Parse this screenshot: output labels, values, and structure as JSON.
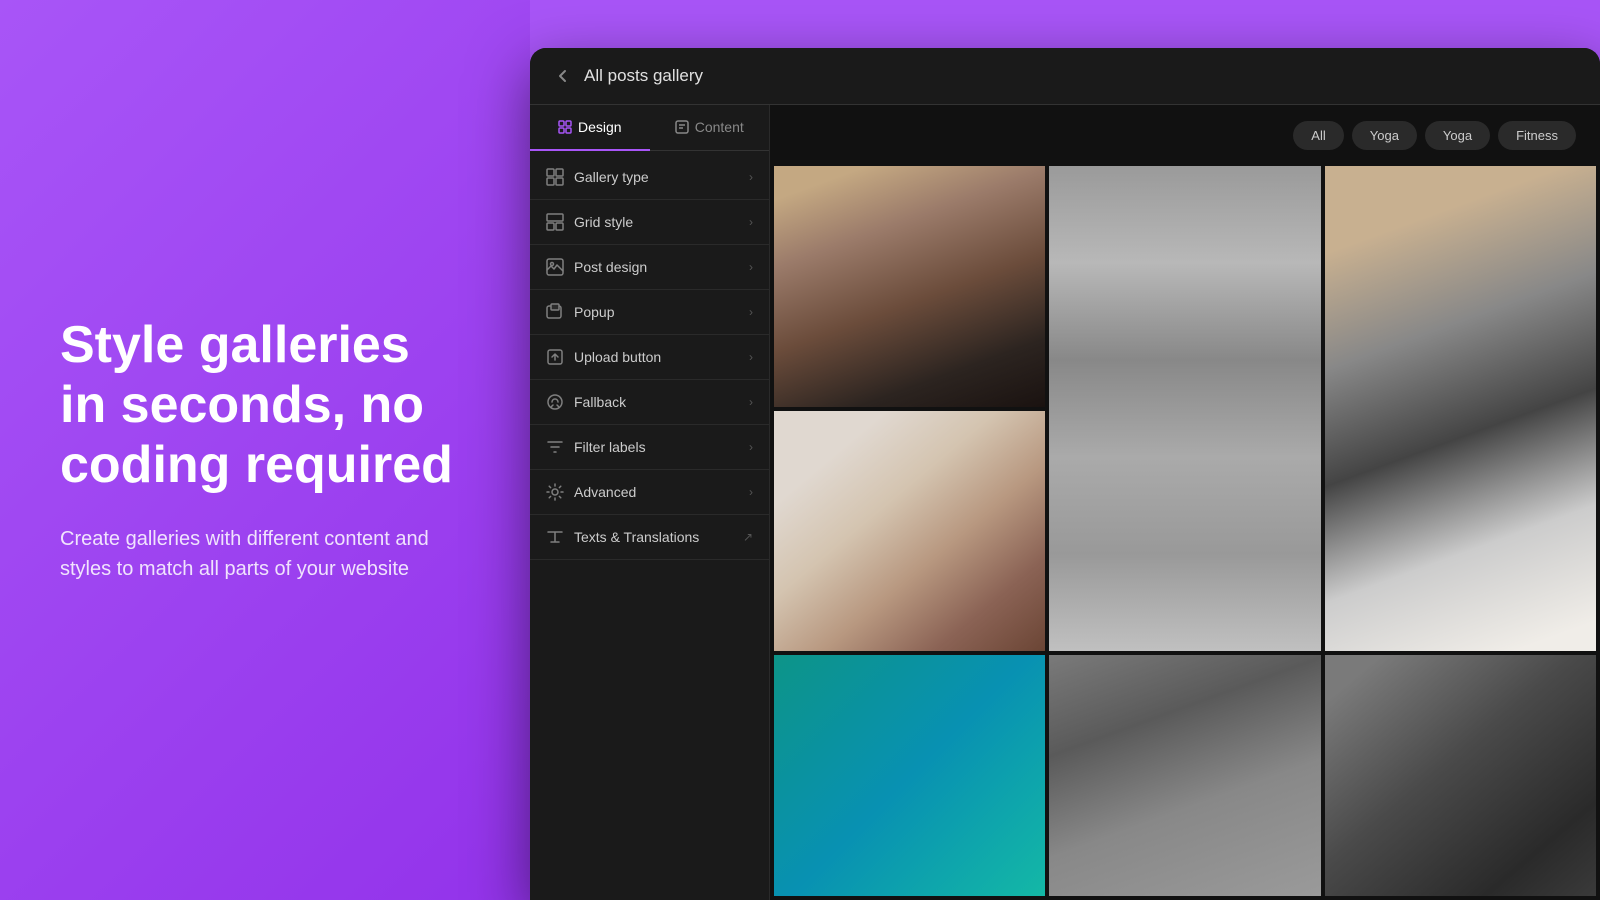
{
  "left": {
    "headline": "Style galleries\nin seconds, no\ncoding required",
    "subtext": "Create galleries with different content and styles to match all parts of your website"
  },
  "window": {
    "title": "All posts gallery",
    "back_label": "←",
    "tabs": [
      {
        "id": "design",
        "label": "Design",
        "icon": "design-icon",
        "active": true
      },
      {
        "id": "content",
        "label": "Content",
        "icon": "content-icon",
        "active": false
      }
    ],
    "menu_items": [
      {
        "id": "gallery-type",
        "label": "Gallery type",
        "icon": "grid-icon",
        "has_arrow": true,
        "has_external": false
      },
      {
        "id": "grid-style",
        "label": "Grid style",
        "icon": "grid2-icon",
        "has_arrow": true,
        "has_external": false
      },
      {
        "id": "post-design",
        "label": "Post design",
        "icon": "image-icon",
        "has_arrow": true,
        "has_external": false
      },
      {
        "id": "popup",
        "label": "Popup",
        "icon": "popup-icon",
        "has_arrow": true,
        "has_external": false
      },
      {
        "id": "upload-button",
        "label": "Upload button",
        "icon": "upload-icon",
        "has_arrow": true,
        "has_external": false
      },
      {
        "id": "fallback",
        "label": "Fallback",
        "icon": "fallback-icon",
        "has_arrow": true,
        "has_external": false
      },
      {
        "id": "filter-labels",
        "label": "Filter labels",
        "icon": "filter-icon",
        "has_arrow": true,
        "has_external": false
      },
      {
        "id": "advanced",
        "label": "Advanced",
        "icon": "settings-icon",
        "has_arrow": true,
        "has_external": false
      },
      {
        "id": "texts-translations",
        "label": "Texts & Translations",
        "icon": "text-icon",
        "has_arrow": false,
        "has_external": true
      }
    ],
    "filter_pills": [
      {
        "id": "all",
        "label": "All",
        "active": false
      },
      {
        "id": "yoga1",
        "label": "Yoga",
        "active": false
      },
      {
        "id": "yoga2",
        "label": "Yoga",
        "active": false
      },
      {
        "id": "fitness",
        "label": "Fitness",
        "active": false
      }
    ]
  }
}
